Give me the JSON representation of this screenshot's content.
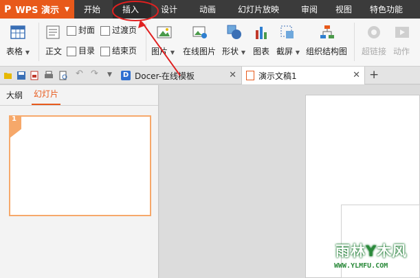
{
  "menubar": {
    "app_label": "WPS 演示",
    "items": [
      "开始",
      "插入",
      "设计",
      "动画",
      "幻灯片放映",
      "审阅",
      "视图",
      "特色功能"
    ],
    "active_item": "插入"
  },
  "ribbon": {
    "table": "表格",
    "body_text": "正文",
    "cover": "封面",
    "toc": "目录",
    "transition": "过渡页",
    "ending": "结束页",
    "picture": "图片",
    "online_picture": "在线图片",
    "shape": "形状",
    "chart": "图表",
    "screenshot": "截屏",
    "org_chart": "组织结构图",
    "hyperlink": "超链接",
    "action": "动作"
  },
  "tabs": {
    "docer": "Docer-在线模板",
    "doc1": "演示文稿1"
  },
  "left_pane": {
    "outline_tab": "大纲",
    "slides_tab": "幻灯片",
    "slide_number": "1"
  },
  "watermark": {
    "brand": "雨林木风",
    "url": "WWW.YLMFU.COM"
  },
  "colors": {
    "accent": "#e8591a",
    "menubar_bg": "#3b3b3b",
    "annotation": "#e02020"
  }
}
